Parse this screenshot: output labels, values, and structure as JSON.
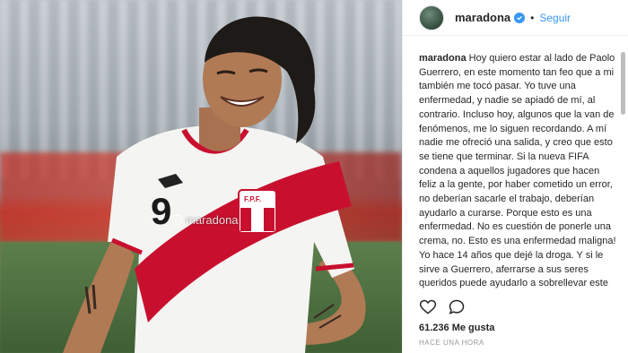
{
  "post": {
    "watermark": "maradona",
    "username": "maradona",
    "separator": "•",
    "follow_label": "Seguir",
    "caption_user": "maradona",
    "caption_text": "Hoy quiero estar al lado de Paolo Guerrero, en este momento tan feo que a mi también me tocó pasar. Yo tuve una enfermedad, y nadie se apiadó de mí, al contrario. Incluso hoy, algunos que la van de fenómenos, me lo siguen recordando. A mí nadie me ofreció una salida, y creo que esto se tiene que terminar. Si la nueva FIFA condena a aquellos jugadores que hacen feliz a la gente, por haber cometido un error, no deberían sacarle el trabajo, deberían ayudarlo a curarse. Porque esto es una enfermedad. No es cuestión de ponerle una crema, no. Esto es una enfermedad maligna! Yo hace 14 años que dejé la droga. Y si le sirve a Guerrero, aferrarse a sus seres queridos puede ayudarlo a sobrellevar este momento. Los doctores de FIFA están ahí para cobrar su sueldo, para",
    "likes": "61.236 Me gusta",
    "time": "HACE UNA HORA",
    "jersey_number": "9",
    "badge_text": "F.P.F."
  },
  "icons": {
    "verified": "verified-badge-icon",
    "like": "heart-icon",
    "comment": "comment-icon",
    "watermark": "instagram-icon"
  },
  "colors": {
    "accent": "#3897f0",
    "jersey_red": "#c8102e",
    "text": "#262626",
    "muted": "#999999"
  }
}
